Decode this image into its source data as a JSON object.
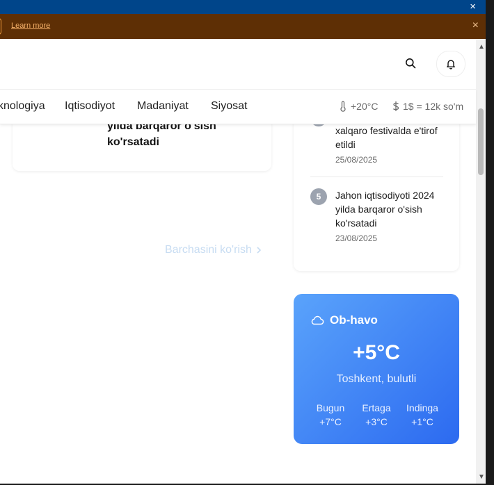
{
  "banner": {
    "learn_more": "Learn more",
    "close": "×"
  },
  "topbar": {
    "close": "×"
  },
  "nav": {
    "items": [
      "knologiya",
      "Iqtisodiyot",
      "Madaniyat",
      "Siyosat"
    ],
    "temperature": "+20°C",
    "currency": "1$ = 12k so'm"
  },
  "left_card": {
    "title": "yilda barqaror o'sish ko'rsatadi"
  },
  "view_all": "Barchasini ko'rish",
  "news": [
    {
      "number": "",
      "title": "xalqaro festivalda e'tirof etildi",
      "date": "25/08/2025"
    },
    {
      "number": "5",
      "title": "Jahon iqtisodiyoti 2024 yilda barqaror o'sish ko'rsatadi",
      "date": "23/08/2025"
    }
  ],
  "weather": {
    "title": "Ob-havo",
    "temp": "+5°C",
    "desc": "Toshkent, bulutli",
    "days": [
      {
        "name": "Bugun",
        "temp": "+7°C"
      },
      {
        "name": "Ertaga",
        "temp": "+3°C"
      },
      {
        "name": "Indinga",
        "temp": "+1°C"
      }
    ]
  },
  "colors": {
    "topbar": "#00458a",
    "promo": "#5e2f05",
    "link": "#f7b26a",
    "weather_start": "#5aa3fb",
    "weather_end": "#2c6af0"
  },
  "icons": [
    "search-icon",
    "bell-icon",
    "thermometer-icon",
    "dollar-icon",
    "chevron-right-icon",
    "cloud-icon",
    "close-icon"
  ]
}
